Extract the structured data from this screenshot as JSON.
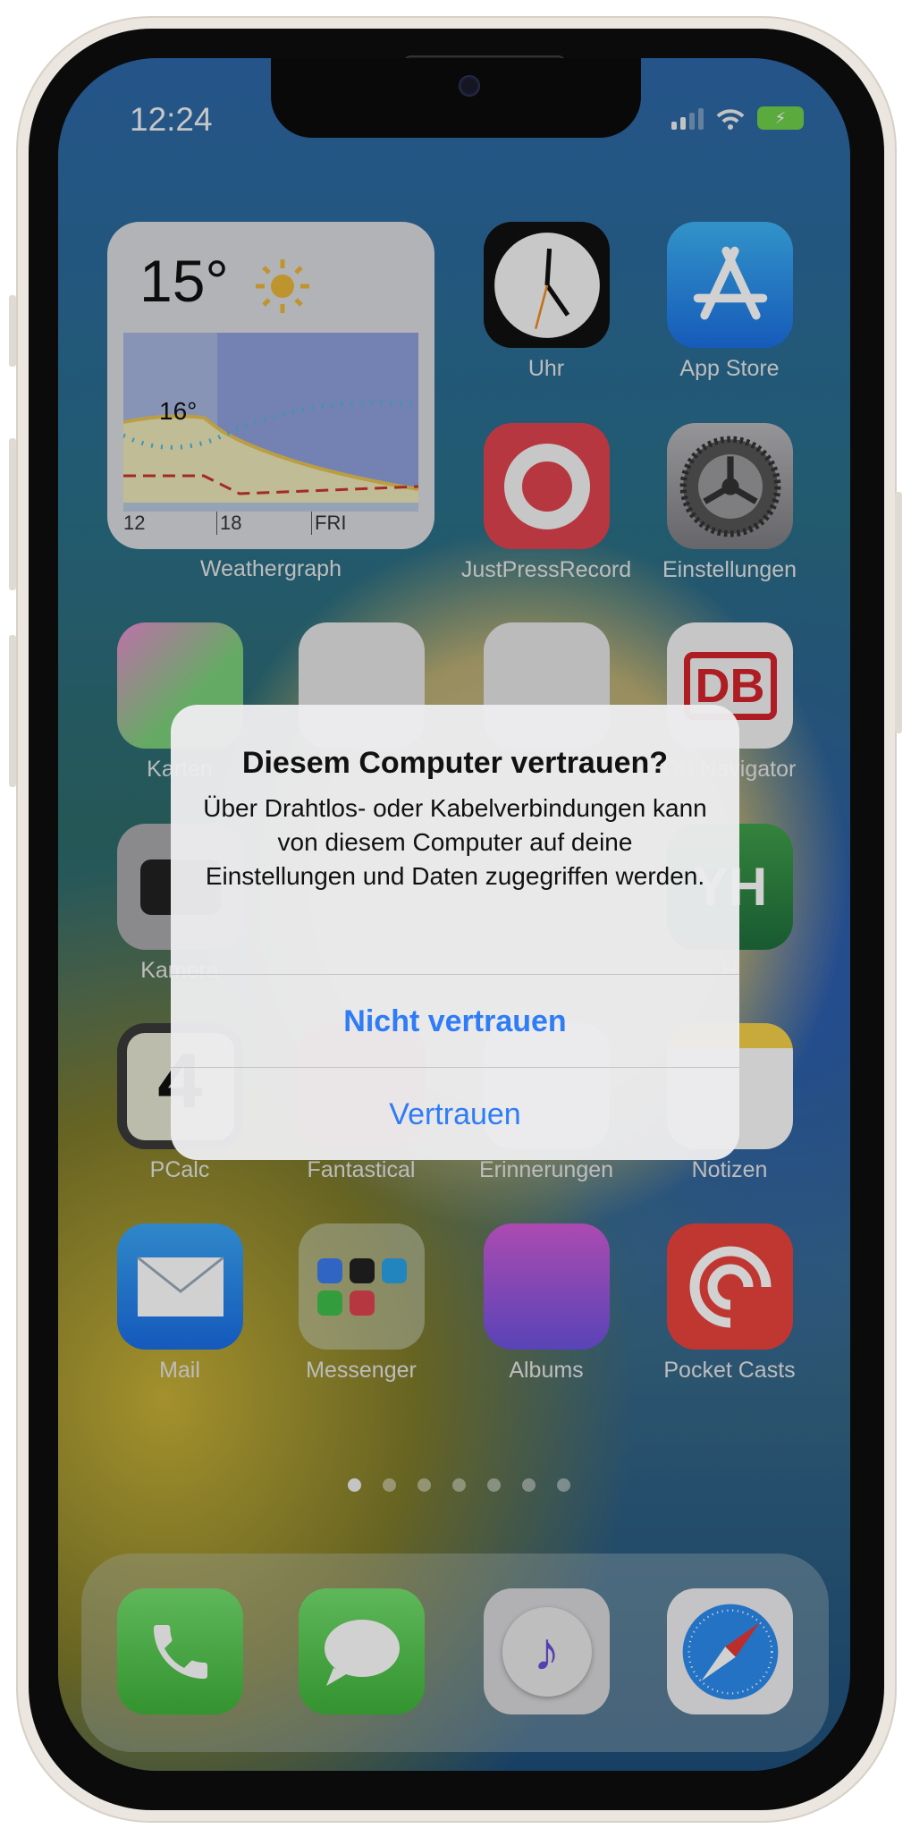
{
  "status_bar": {
    "time": "12:24",
    "battery_state": "charging"
  },
  "widget": {
    "app": "Weathergraph",
    "current_temp": "15°",
    "condition_icon": "sun-icon",
    "graph_label": "16°",
    "axis_labels": [
      "12",
      "18",
      "FRI"
    ]
  },
  "apps": [
    {
      "label": "Uhr",
      "icon": "clock-icon"
    },
    {
      "label": "App Store",
      "icon": "app-store-icon"
    },
    {
      "label": "JustPressRecord",
      "icon": "record-icon"
    },
    {
      "label": "Einstellungen",
      "icon": "settings-gear-icon"
    },
    {
      "label": "Karten",
      "icon": "maps-icon"
    },
    {
      "label": "",
      "icon": "bird-app-icon"
    },
    {
      "label": "",
      "icon": "globe-app-icon"
    },
    {
      "label": "DB Navigator",
      "icon": "db-icon",
      "glyph": "DB"
    },
    {
      "label": "Kamera",
      "icon": "camera-icon"
    },
    {
      "label": "",
      "icon": "hidden-app-icon"
    },
    {
      "label": "",
      "icon": "hidden-app-icon"
    },
    {
      "label": "H",
      "icon": "green-app-icon",
      "glyph": "YH"
    },
    {
      "label": "PCalc",
      "icon": "pcalc-icon",
      "glyph": "4"
    },
    {
      "label": "Fantastical",
      "icon": "fantastical-icon"
    },
    {
      "label": "Erinnerungen",
      "icon": "reminders-icon"
    },
    {
      "label": "Notizen",
      "icon": "notes-icon"
    },
    {
      "label": "Mail",
      "icon": "mail-icon"
    },
    {
      "label": "Messenger",
      "icon": "folder-icon"
    },
    {
      "label": "Albums",
      "icon": "albums-icon"
    },
    {
      "label": "Pocket Casts",
      "icon": "pocket-casts-icon"
    }
  ],
  "page_dots": {
    "count": 7,
    "active": 1
  },
  "dock": [
    {
      "icon": "phone-icon"
    },
    {
      "icon": "messages-icon"
    },
    {
      "icon": "music-icon",
      "glyph": "♪"
    },
    {
      "icon": "safari-icon"
    }
  ],
  "dialog": {
    "title": "Diesem Computer vertrauen?",
    "message": "Über Drahtlos- oder Kabelverbindungen kann von diesem Computer auf deine Einstellungen und Daten zugegriffen werden.",
    "primary_button": "Nicht vertrauen",
    "secondary_button": "Vertrauen",
    "button_color": "#2e7cf6"
  }
}
